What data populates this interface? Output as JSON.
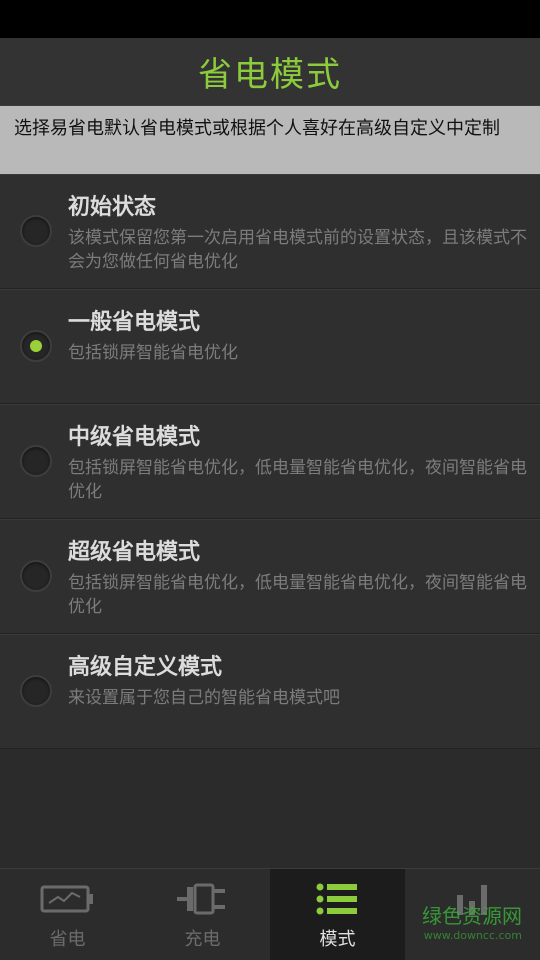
{
  "title": "省电模式",
  "notice": "选择易省电默认省电模式或根据个人喜好在高级自定义中定制",
  "modes": [
    {
      "title": "初始状态",
      "desc": "该模式保留您第一次启用省电模式前的设置状态，且该模式不会为您做任何省电优化",
      "selected": false
    },
    {
      "title": "一般省电模式",
      "desc": "包括锁屏智能省电优化",
      "selected": true
    },
    {
      "title": "中级省电模式",
      "desc": "包括锁屏智能省电优化，低电量智能省电优化，夜间智能省电优化",
      "selected": false
    },
    {
      "title": "超级省电模式",
      "desc": "包括锁屏智能省电优化，低电量智能省电优化，夜间智能省电优化",
      "selected": false
    },
    {
      "title": "高级自定义模式",
      "desc": "来设置属于您自己的智能省电模式吧",
      "selected": false
    }
  ],
  "bottom_nav": [
    {
      "label": "省电",
      "icon": "battery-icon",
      "active": false
    },
    {
      "label": "充电",
      "icon": "plug-icon",
      "active": false
    },
    {
      "label": "模式",
      "icon": "list-icon",
      "active": true
    },
    {
      "label": "",
      "icon": "bar-chart-icon",
      "active": false
    }
  ],
  "watermark": {
    "text": "绿色资源网",
    "sub": "www.downcc.com"
  },
  "colors": {
    "accent": "#8ccc3c",
    "background": "#2b2b2b",
    "notice_bg": "#b9b9b9"
  }
}
